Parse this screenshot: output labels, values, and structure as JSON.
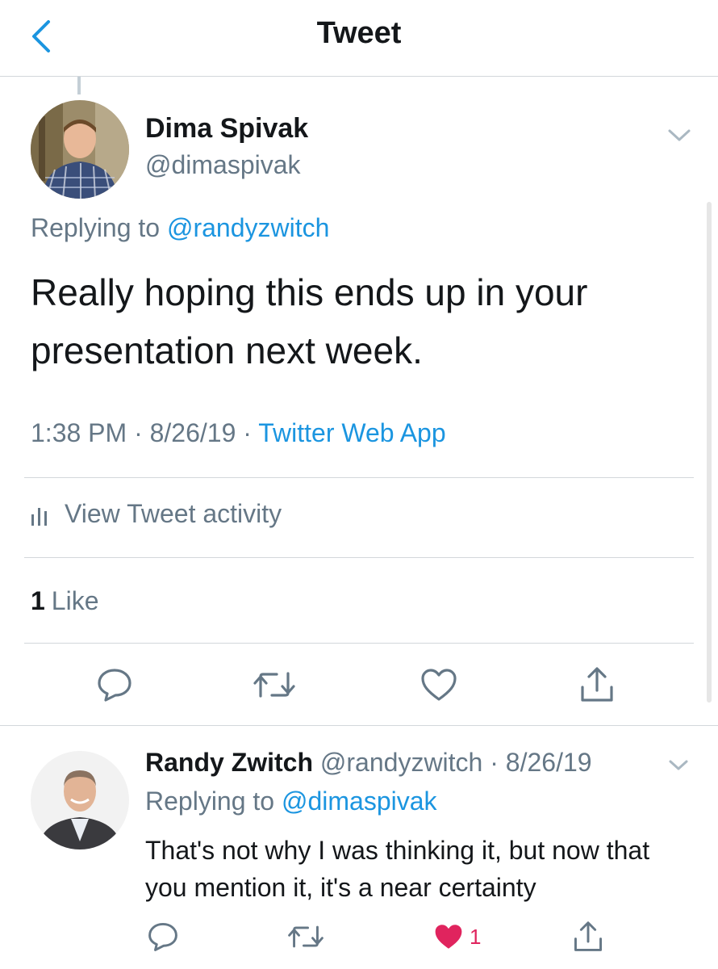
{
  "header": {
    "title": "Tweet"
  },
  "tweet": {
    "author_name": "Dima Spivak",
    "author_handle": "@dimaspivak",
    "replying_prefix": "Replying to ",
    "replying_to": "@randyzwitch",
    "text": "Really hoping this ends up in your presentation next week.",
    "time": "1:38 PM",
    "date": "8/26/19",
    "source": "Twitter Web App",
    "dot": " · ",
    "activity_label": "View Tweet activity",
    "like_count": "1",
    "like_label": "Like"
  },
  "reply": {
    "author_name": "Randy Zwitch",
    "author_handle": "@randyzwitch",
    "date": "8/26/19",
    "dot": " · ",
    "replying_prefix": "Replying to ",
    "replying_to": "@dimaspivak",
    "text": "That's not why I was thinking it, but now that you mention it, it's a near certainty",
    "like_count": "1"
  },
  "colors": {
    "accent": "#1b95e0",
    "secondary": "#657786",
    "like": "#e0245e",
    "divider": "#d3d7db"
  }
}
